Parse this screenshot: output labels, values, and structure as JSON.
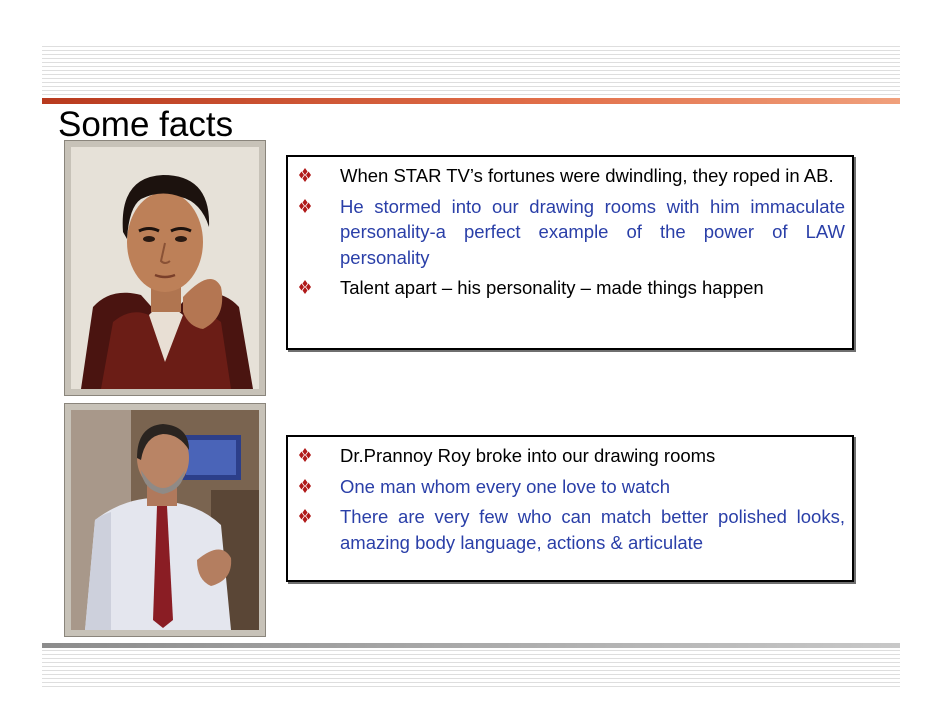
{
  "slide": {
    "title": "Some facts",
    "colors": {
      "accent_rule": "#c8452a",
      "blue_text": "#2a3fa8",
      "bullet": "#b01a1a"
    },
    "bullet_icon": "four-diamond-bullet-icon",
    "box1": {
      "items": [
        {
          "text": "When STAR TV’s fortunes were dwindling, they roped in AB.",
          "color": "black"
        },
        {
          "text": "He stormed into our drawing rooms with him immaculate personality-a perfect example of the power of LAW personality",
          "color": "blue"
        },
        {
          "text": "Talent apart – his personality – made things happen",
          "color": "black"
        }
      ]
    },
    "box2": {
      "items": [
        {
          "text": "Dr.Prannoy Roy broke into our drawing rooms",
          "color": "black"
        },
        {
          "text": "One man whom every one love to watch",
          "color": "blue"
        },
        {
          "text": "There are very few who can match better polished looks, amazing body language, actions & articulate",
          "color": "blue"
        }
      ]
    }
  }
}
